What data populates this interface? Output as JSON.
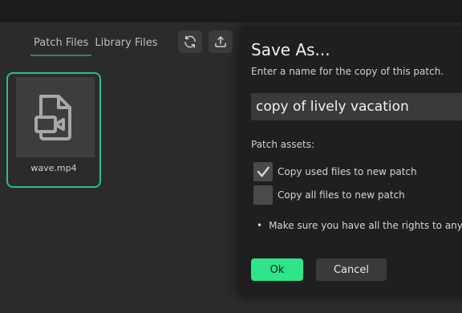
{
  "tabs": [
    {
      "label": "Patch Files",
      "active": true
    },
    {
      "label": "Library Files",
      "active": false
    }
  ],
  "toolbar": {
    "refresh_icon": "refresh-icon",
    "upload_icon": "upload-icon"
  },
  "files": [
    {
      "name": "wave.mp4",
      "icon": "video-file-icon",
      "selected": true
    }
  ],
  "dialog": {
    "title": "Save As...",
    "subtitle": "Enter a name for the copy of this patch.",
    "name_value": "copy of lively vacation",
    "assets_label": "Patch assets:",
    "options": [
      {
        "label": "Copy used files to new patch",
        "checked": true
      },
      {
        "label": "Copy all files to new patch",
        "checked": false
      }
    ],
    "note": "Make sure you have all the rights to any as",
    "ok_label": "Ok",
    "cancel_label": "Cancel"
  },
  "colors": {
    "accent": "#2ee58a",
    "selection_border": "#2fbf7e",
    "background": "#2b2b2b",
    "dialog_bg": "#1f1f1f"
  }
}
